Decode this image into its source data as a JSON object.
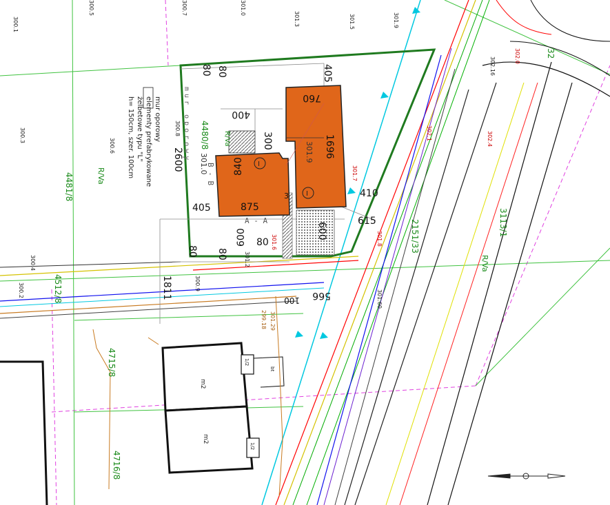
{
  "parcels": {
    "p4481": "4481/8",
    "p4480": "4480/8",
    "p4512": "4512/8",
    "p4715": "4715/8",
    "p4716": "4716/8",
    "p2151": "2151/33",
    "p3113": "3113/1",
    "p32": "32"
  },
  "zoning": {
    "r1": "R/Va",
    "r2": "R/Va",
    "r3": "R/Va"
  },
  "dims": {
    "d405_top": "405",
    "d80_a": "80",
    "d80_b": "80",
    "d760": "760",
    "d1696": "1696",
    "d400": "400",
    "d300": "300",
    "d2600": "2600",
    "d840": "840",
    "d875": "875",
    "d405_left": "405",
    "d410": "410",
    "d615": "615",
    "d600_right": "600",
    "d600_bottom": "600",
    "d80_c": "80",
    "d80_d": "80",
    "d80_e": "80",
    "d1811": "1811",
    "d566": "566",
    "d100": "100",
    "d3": "3"
  },
  "building": {
    "marker": "I",
    "label_3019": "301.9",
    "label_3010": "301.0",
    "sec_a": "A - A",
    "sec_b": "B - B",
    "wall": "mur oporowy"
  },
  "note": {
    "line1": "mur oporowy",
    "line2": "elementy prefabrykowane",
    "line3": "żelbetowe typu \"L\"",
    "line4": "h= 150cm, szer. 100cm"
  },
  "elev": [
    "300.5",
    "300.7",
    "301.3",
    "301.5",
    "301.9",
    "300.1",
    "300.3",
    "300.6",
    "301.0",
    "300.8",
    "302.0",
    "302.1",
    "302.4",
    "301.8",
    "301.6",
    "301.7",
    "300.9",
    "301.2",
    "300.2",
    "301.60",
    "301.29",
    "300.4",
    "302.16",
    "299.18"
  ],
  "garage": {
    "m2_top": "m2",
    "m2_bottom": "m2",
    "small1": "1/2",
    "small2": "1/2",
    "bt": "bt"
  }
}
